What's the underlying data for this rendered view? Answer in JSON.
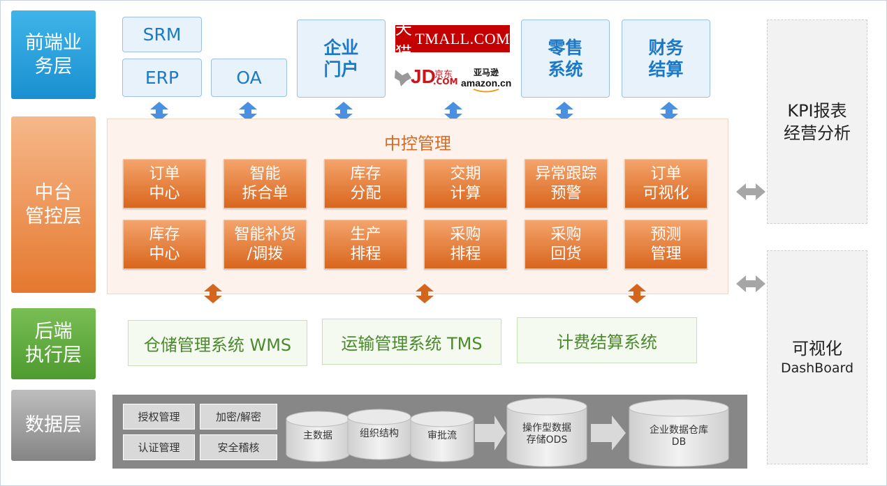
{
  "layers": {
    "front": "前端业\n务层",
    "middle": "中台\n管控层",
    "backend": "后端\n执行层",
    "data": "数据层"
  },
  "front": {
    "srm": "SRM",
    "erp": "ERP",
    "oa": "OA",
    "portal": "企业\n门户",
    "retail": "零售\n系统",
    "finance": "财务\n结算",
    "logos": {
      "tmall_cn": "天猫",
      "tmall_en": "TMALL.COM",
      "jd": "JD",
      "jd_cn": "京东",
      "jd_com": ".COM",
      "amazon_cn": "亚马逊",
      "amazon": "amazon.cn"
    }
  },
  "middle": {
    "title": "中控管理",
    "modules": [
      "订单\n中心",
      "智能\n拆合单",
      "库存\n分配",
      "交期\n计算",
      "异常跟踪\n预警",
      "订单\n可视化",
      "库存\n中心",
      "智能补货\n/调拨",
      "生产\n排程",
      "采购\n排程",
      "采购\n回货",
      "预测\n管理"
    ]
  },
  "backend": {
    "wms": "仓储管理系统 WMS",
    "tms": "运输管理系统 TMS",
    "billing": "计费结算系统"
  },
  "data_layer": {
    "security": [
      "授权管理",
      "加密/解密",
      "认证管理",
      "安全稽核"
    ],
    "cylinders": [
      "主数据",
      "组织结构",
      "审批流"
    ],
    "ods": "操作型数据\n存储ODS",
    "dw": "企业数据仓库\nDB"
  },
  "right": {
    "kpi": "KPI报表\n经营分析",
    "visual_cn": "可视化",
    "visual_en": "DashBoard"
  },
  "colors": {
    "front_blue": "#1a8fd0",
    "middle_orange": "#e5782f",
    "backend_green": "#4e9b2f",
    "data_gray": "#858585",
    "arrow_blue": "#4a90e2",
    "arrow_orange": "#d4651f",
    "arrow_gray": "#a6a6a6"
  }
}
